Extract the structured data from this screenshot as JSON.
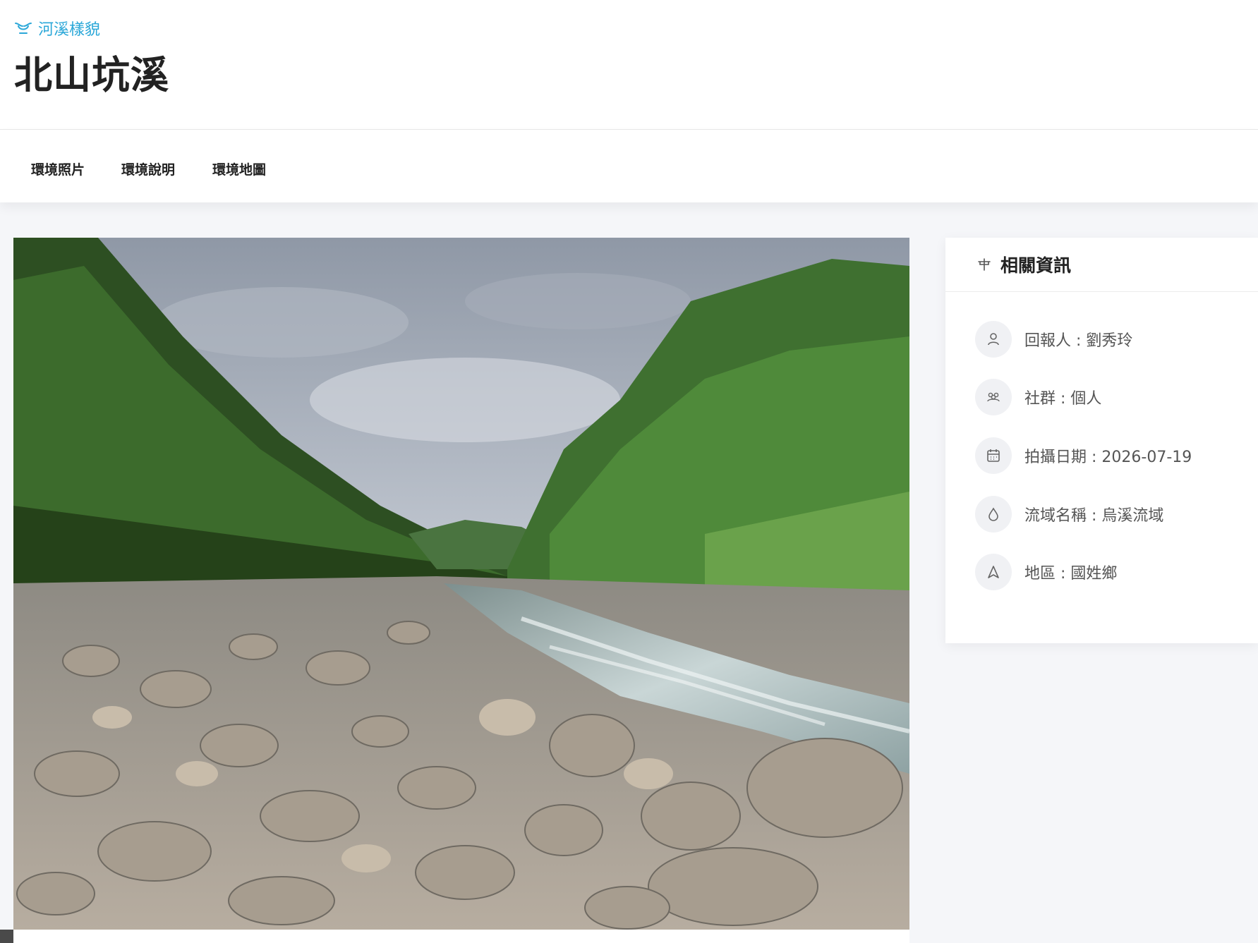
{
  "header": {
    "category_label": "河溪樣貌",
    "title": "北山坑溪"
  },
  "tabs": [
    {
      "label": "環境照片"
    },
    {
      "label": "環境說明"
    },
    {
      "label": "環境地圖"
    }
  ],
  "photo": {
    "icon": "river-landscape-photo"
  },
  "info_panel": {
    "title": "相關資訊",
    "items": [
      {
        "icon": "user-icon",
        "text": "回報人 : 劉秀玲"
      },
      {
        "icon": "group-icon",
        "text": "社群 : 個人"
      },
      {
        "icon": "calendar-icon",
        "text": "拍攝日期 : 2026-07-19"
      },
      {
        "icon": "water-drop-icon",
        "text": "流域名稱 : 烏溪流域"
      },
      {
        "icon": "location-arrow-icon",
        "text": "地區 : 國姓鄉"
      }
    ]
  },
  "colors": {
    "accent": "#2aa7d8",
    "background": "#f5f6f9",
    "title": "#222222"
  }
}
